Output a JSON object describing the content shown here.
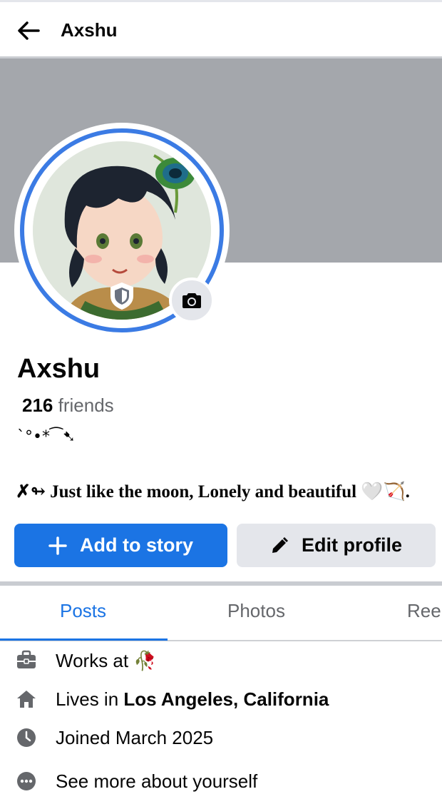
{
  "header": {
    "title": "Axshu"
  },
  "profile": {
    "name": "Axshu",
    "friends_count": "216",
    "friends_label": "friends",
    "decoration": "`°•*⁀➷",
    "bio": "✗↬ Just like the moon, Lonely and beautiful 🤍🏹."
  },
  "actions": {
    "add_story": "Add to story",
    "edit_profile": "Edit profile"
  },
  "tabs": [
    {
      "label": "Posts",
      "active": true
    },
    {
      "label": "Photos",
      "active": false
    },
    {
      "label": "Reels",
      "active": false
    }
  ],
  "about": {
    "works_prefix": "Works at",
    "works_emoji": "🥀",
    "lives_prefix": "Lives in",
    "lives_place": "Los Angeles, California",
    "joined": "Joined March 2025",
    "see_more": "See more about yourself"
  },
  "colors": {
    "accent": "#1b74e4",
    "cover": "#a4a7ac",
    "ring": "#3b7be4",
    "secondary_button": "#e4e6eb",
    "muted_text": "#65676b"
  },
  "icons": {
    "back": "arrow-left-icon",
    "camera": "camera-icon",
    "shield": "shield-icon",
    "plus": "plus-icon",
    "pencil": "pencil-icon",
    "work": "briefcase-icon",
    "home": "home-icon",
    "clock": "clock-icon",
    "more": "more-dots-icon"
  }
}
